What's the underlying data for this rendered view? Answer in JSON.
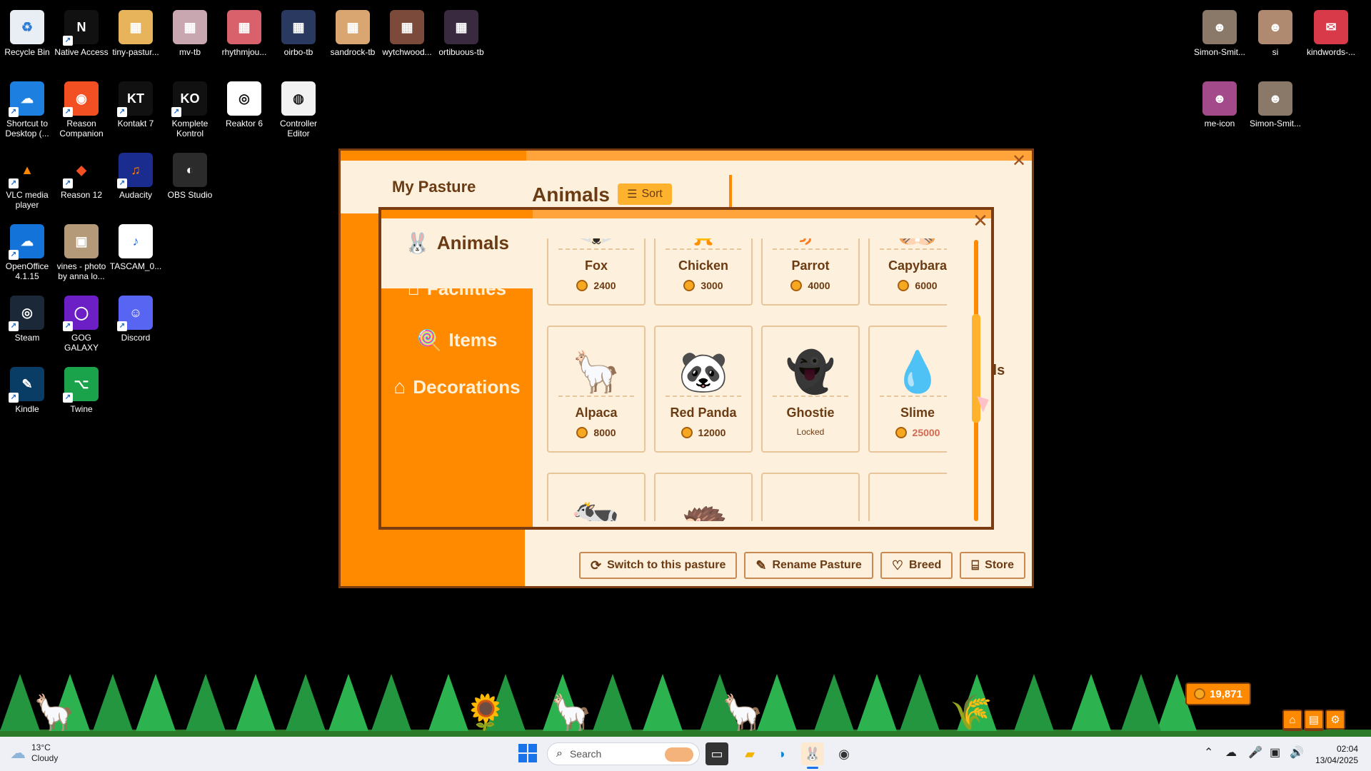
{
  "desktop": {
    "icons": [
      {
        "label": "Recycle Bin",
        "glyph": "♻",
        "color": "#e9eef4",
        "fg": "#2a7bd8",
        "shortcut": false
      },
      {
        "label": "Native Access",
        "glyph": "N",
        "color": "#111111",
        "fg": "#ffffff",
        "shortcut": true
      },
      {
        "label": "tiny-pastur...",
        "glyph": "▦",
        "color": "#e7b45c",
        "fg": "#ffffff",
        "shortcut": false
      },
      {
        "label": "mv-tb",
        "glyph": "▦",
        "color": "#c9a7b0",
        "fg": "#ffffff",
        "shortcut": false
      },
      {
        "label": "rhythmjou...",
        "glyph": "▦",
        "color": "#d8616c",
        "fg": "#ffffff",
        "shortcut": false
      },
      {
        "label": "oirbo-tb",
        "glyph": "▦",
        "color": "#2a3960",
        "fg": "#ffffff",
        "shortcut": false
      },
      {
        "label": "sandrock-tb",
        "glyph": "▦",
        "color": "#d9a672",
        "fg": "#ffffff",
        "shortcut": false
      },
      {
        "label": "wytchwood...",
        "glyph": "▦",
        "color": "#7c4a3a",
        "fg": "#ffffff",
        "shortcut": false
      },
      {
        "label": "ortibuous-tb",
        "glyph": "▦",
        "color": "#3a2a40",
        "fg": "#ffffff",
        "shortcut": false
      },
      {
        "label": "Shortcut to Desktop (...",
        "glyph": "☁",
        "color": "#1d7fe0",
        "fg": "#ffffff",
        "shortcut": true
      },
      {
        "label": "Reason Companion",
        "glyph": "◉",
        "color": "#f25022",
        "fg": "#ffffff",
        "shortcut": true
      },
      {
        "label": "Kontakt 7",
        "glyph": "KT",
        "color": "#111111",
        "fg": "#ffffff",
        "shortcut": true
      },
      {
        "label": "Komplete Kontrol",
        "glyph": "KO",
        "color": "#111111",
        "fg": "#ffffff",
        "shortcut": true
      },
      {
        "label": "Reaktor 6",
        "glyph": "◎",
        "color": "#ffffff",
        "fg": "#111111",
        "shortcut": false
      },
      {
        "label": "Controller Editor",
        "glyph": "◍",
        "color": "#f2f2f2",
        "fg": "#222222",
        "shortcut": false
      },
      {
        "label": "VLC media player",
        "glyph": "▲",
        "color": "#000000",
        "fg": "#ff8800",
        "shortcut": true
      },
      {
        "label": "Reason 12",
        "glyph": "◆",
        "color": "#000000",
        "fg": "#f25022",
        "shortcut": true
      },
      {
        "label": "Audacity",
        "glyph": "♫",
        "color": "#1b2c8f",
        "fg": "#ff7b00",
        "shortcut": true
      },
      {
        "label": "OBS Studio",
        "glyph": "◐",
        "color": "#2b2b2b",
        "fg": "#ffffff",
        "shortcut": false
      },
      {
        "label": "OpenOffice 4.1.15",
        "glyph": "☁",
        "color": "#1473d8",
        "fg": "#ffffff",
        "shortcut": true
      },
      {
        "label": "vines - photo by anna lo...",
        "glyph": "▣",
        "color": "#b59a7a",
        "fg": "#ffffff",
        "shortcut": false
      },
      {
        "label": "TASCAM_0...",
        "glyph": "♪",
        "color": "#ffffff",
        "fg": "#2a6cd6",
        "shortcut": false
      },
      {
        "label": "Steam",
        "glyph": "◎",
        "color": "#1b2838",
        "fg": "#ffffff",
        "shortcut": true
      },
      {
        "label": "GOG GALAXY",
        "glyph": "◯",
        "color": "#6d1fc6",
        "fg": "#ffffff",
        "shortcut": true
      },
      {
        "label": "Discord",
        "glyph": "☺",
        "color": "#5865f2",
        "fg": "#ffffff",
        "shortcut": true
      },
      {
        "label": "Kindle",
        "glyph": "✎",
        "color": "#0a3d66",
        "fg": "#ffffff",
        "shortcut": true
      },
      {
        "label": "Twine",
        "glyph": "⌥",
        "color": "#1aa34a",
        "fg": "#ffffff",
        "shortcut": true
      },
      {
        "label": "Simon-Smit...",
        "glyph": "☻",
        "color": "#8a7868",
        "fg": "#ffffff",
        "shortcut": false
      },
      {
        "label": "si",
        "glyph": "☻",
        "color": "#b08a70",
        "fg": "#ffffff",
        "shortcut": false
      },
      {
        "label": "kindwords-...",
        "glyph": "✉",
        "color": "#d83a4a",
        "fg": "#ffffff",
        "shortcut": false
      },
      {
        "label": "me-icon",
        "glyph": "☻",
        "color": "#a34a8a",
        "fg": "#ffffff",
        "shortcut": false
      },
      {
        "label": "Simon-Smit...",
        "glyph": "☻",
        "color": "#8a7868",
        "fg": "#ffffff",
        "shortcut": false
      }
    ]
  },
  "pasture": {
    "title": "My Pasture",
    "section": "Animals",
    "sort_label": "Sort",
    "details_peek": "ils",
    "buttons": [
      {
        "label": "Switch to this pasture",
        "icon": "⟳"
      },
      {
        "label": "Rename Pasture",
        "icon": "✎"
      },
      {
        "label": "Breed",
        "icon": "♡"
      },
      {
        "label": "Store",
        "icon": "⌸"
      }
    ]
  },
  "store": {
    "categories": [
      {
        "label": "Animals",
        "icon": "🐰",
        "active": true
      },
      {
        "label": "Facilities",
        "icon": "⌂",
        "active": false
      },
      {
        "label": "Items",
        "icon": "🍭",
        "active": false
      },
      {
        "label": "Decorations",
        "icon": "⌂",
        "active": false
      }
    ],
    "animals": [
      {
        "name": "Fox",
        "price": "2400",
        "art": "🦊",
        "state": "normal"
      },
      {
        "name": "Chicken",
        "price": "3000",
        "art": "🐥",
        "state": "normal"
      },
      {
        "name": "Parrot",
        "price": "4000",
        "art": "🐦",
        "state": "normal"
      },
      {
        "name": "Capybara",
        "price": "6000",
        "art": "🐹",
        "state": "normal"
      },
      {
        "name": "Alpaca",
        "price": "8000",
        "art": "🦙",
        "state": "normal"
      },
      {
        "name": "Red Panda",
        "price": "12000",
        "art": "🐼",
        "state": "normal"
      },
      {
        "name": "Ghostie",
        "price": "Locked",
        "art": "👻",
        "state": "locked"
      },
      {
        "name": "Slime",
        "price": "25000",
        "art": "💧",
        "state": "expensive"
      },
      {
        "name": "",
        "price": "",
        "art": "🐄",
        "state": "partial"
      },
      {
        "name": "",
        "price": "",
        "art": "🦔",
        "state": "partial"
      },
      {
        "name": "",
        "price": "",
        "art": "",
        "state": "partial"
      },
      {
        "name": "",
        "price": "",
        "art": "",
        "state": "partial"
      }
    ]
  },
  "game_strip": {
    "coins": "19,871"
  },
  "taskbar": {
    "temperature": "13°C",
    "condition": "Cloudy",
    "search_placeholder": "Search",
    "time": "02:04",
    "date": "13/04/2025"
  }
}
